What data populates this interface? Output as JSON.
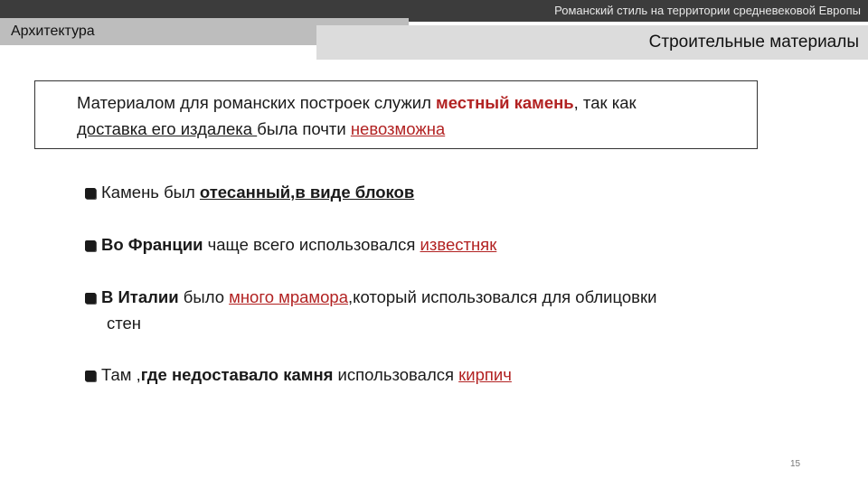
{
  "header": {
    "subject": "Романский стиль на территории средневековой Европы",
    "section": "Архитектура",
    "heading": "Строительные материалы"
  },
  "intro": {
    "t1": "Материалом для романских построек служил ",
    "t2": "местный камень",
    "t3": ", так как ",
    "t4": "доставка его издалека ",
    "t5": "была почти ",
    "t6": "невозможна"
  },
  "bullets": {
    "b1": {
      "t1": "Камень был ",
      "t2": "отесанный,в виде блоков"
    },
    "b2": {
      "t1": "Во Франции",
      "t2": " чаще всего использовался ",
      "t3": "известняк"
    },
    "b3": {
      "t1": "В Италии",
      "t2": " было ",
      "t3": "много мрамора",
      "t4": ",который использовался для облицовки",
      "t5": "стен"
    },
    "b4": {
      "t1": "Там ,",
      "t2": "где недоставало камня",
      "t3": " использовался ",
      "t4": "кирпич"
    }
  },
  "footer": {
    "page_number": "15"
  },
  "colors": {
    "accent_red": "#b22222",
    "topbar": "#3c3c3c",
    "section_tab": "#bdbdbd",
    "heading_band": "#dcdcdc"
  }
}
